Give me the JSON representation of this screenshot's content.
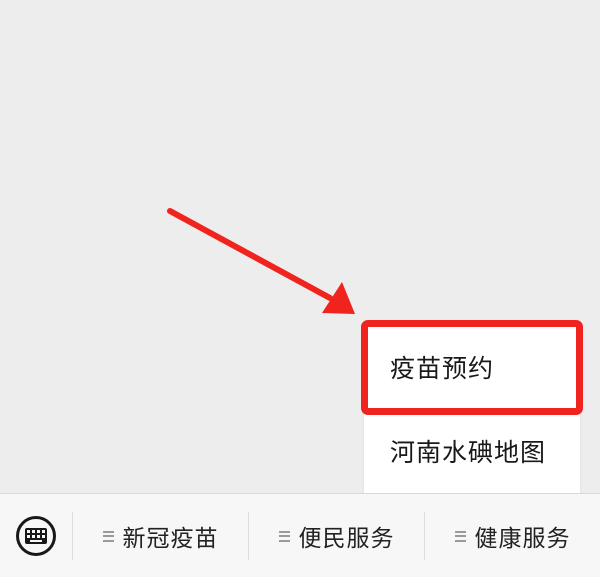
{
  "popup_menu": {
    "items": [
      {
        "label": "疫苗预约"
      },
      {
        "label": "河南水碘地图"
      }
    ]
  },
  "bottom_bar": {
    "tabs": [
      {
        "label": "新冠疫苗"
      },
      {
        "label": "便民服务"
      },
      {
        "label": "健康服务"
      }
    ]
  },
  "colors": {
    "annotation_red": "#f0231e",
    "background": "#ededed",
    "menu_background": "#ffffff"
  },
  "icons": {
    "keyboard": "keyboard-icon",
    "tab_menu": "hamburger-icon",
    "annotation_arrow": "arrow-annotation"
  }
}
